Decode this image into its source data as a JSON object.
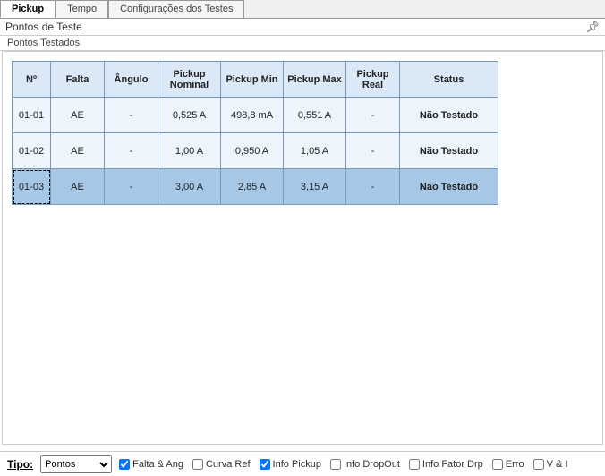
{
  "tabs": [
    {
      "label": "Pickup",
      "active": true
    },
    {
      "label": "Tempo",
      "active": false
    },
    {
      "label": "Configurações dos Testes",
      "active": false
    }
  ],
  "panel_title": "Pontos de Teste",
  "subtitle": "Pontos Testados",
  "table": {
    "headers": {
      "nr": "Nº",
      "falta": "Falta",
      "angulo": "Ângulo",
      "nominal": "Pickup Nominal",
      "min": "Pickup Min",
      "max": "Pickup Max",
      "real": "Pickup Real",
      "status": "Status"
    },
    "rows": [
      {
        "nr": "01-01",
        "falta": "AE",
        "angulo": "-",
        "nominal": "0,525 A",
        "min": "498,8 mA",
        "max": "0,551 A",
        "real": "-",
        "status": "Não Testado",
        "selected": false
      },
      {
        "nr": "01-02",
        "falta": "AE",
        "angulo": "-",
        "nominal": "1,00 A",
        "min": "0,950 A",
        "max": "1,05 A",
        "real": "-",
        "status": "Não Testado",
        "selected": false
      },
      {
        "nr": "01-03",
        "falta": "AE",
        "angulo": "-",
        "nominal": "3,00 A",
        "min": "2,85 A",
        "max": "3,15 A",
        "real": "-",
        "status": "Não Testado",
        "selected": true
      }
    ]
  },
  "footer": {
    "tipo_label": "Tipo:",
    "tipo_value": "Pontos",
    "checks": [
      {
        "label": "Falta & Ang",
        "checked": true
      },
      {
        "label": "Curva Ref",
        "checked": false
      },
      {
        "label": "Info Pickup",
        "checked": true
      },
      {
        "label": "Info DropOut",
        "checked": false
      },
      {
        "label": "Info Fator Drp",
        "checked": false
      },
      {
        "label": "Erro",
        "checked": false
      },
      {
        "label": "V & I",
        "checked": false
      }
    ]
  }
}
